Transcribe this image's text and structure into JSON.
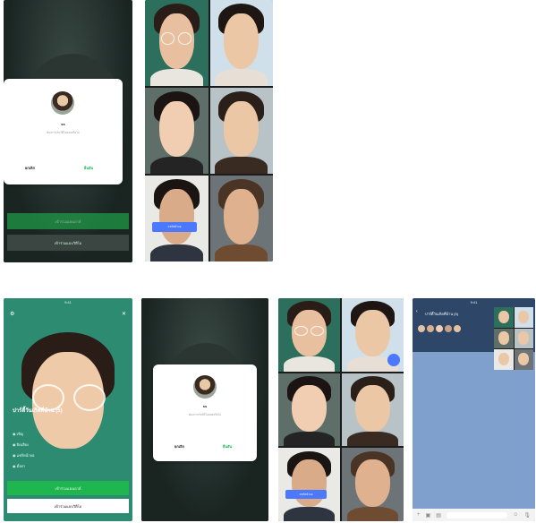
{
  "phone1": {
    "status": "",
    "dialog": {
      "name": "ss",
      "message": "ต้องการเริ่มวิดีโอคอลหรือไม่",
      "cancel_label": "ยกเลิก",
      "confirm_label": "ยืนยัน"
    },
    "green_button": "เข้าร่วมแฮงเอาต์",
    "gray_button": "เข้าร่วมแบบวิดีโอ"
  },
  "phone2": {
    "pill_label": "แชร์หน้าจอ"
  },
  "phone3": {
    "time": "9:41",
    "group_title": "ปาร์ตี้วันเกิดที่บ้าน (5)",
    "menu_items": [
      "เชิญ",
      "ปิดเสียง",
      "แชร์หน้าจอ",
      "ตั้งค่า"
    ],
    "green_button": "เข้าร่วมแฮงเอาต์",
    "white_button": "เข้าร่วมแบบวิดีโอ"
  },
  "phone4": {
    "dialog": {
      "name": "ss",
      "message": "ต้องการเริ่มวิดีโอคอลหรือไม่",
      "cancel_label": "ยกเลิก",
      "confirm_label": "ยืนยัน"
    }
  },
  "phone5": {
    "pill_label": "แชร์หน้าจอ"
  },
  "phone6": {
    "time": "9:41",
    "chat_title": "ปาร์ตี้วันเกิดที่บ้าน (5)"
  },
  "colors": {
    "line_green": "#1fb54f",
    "dark_bg": "#1f2e2a",
    "pill_blue": "#4a78ff",
    "chat_bg": "#7fa0cc"
  }
}
